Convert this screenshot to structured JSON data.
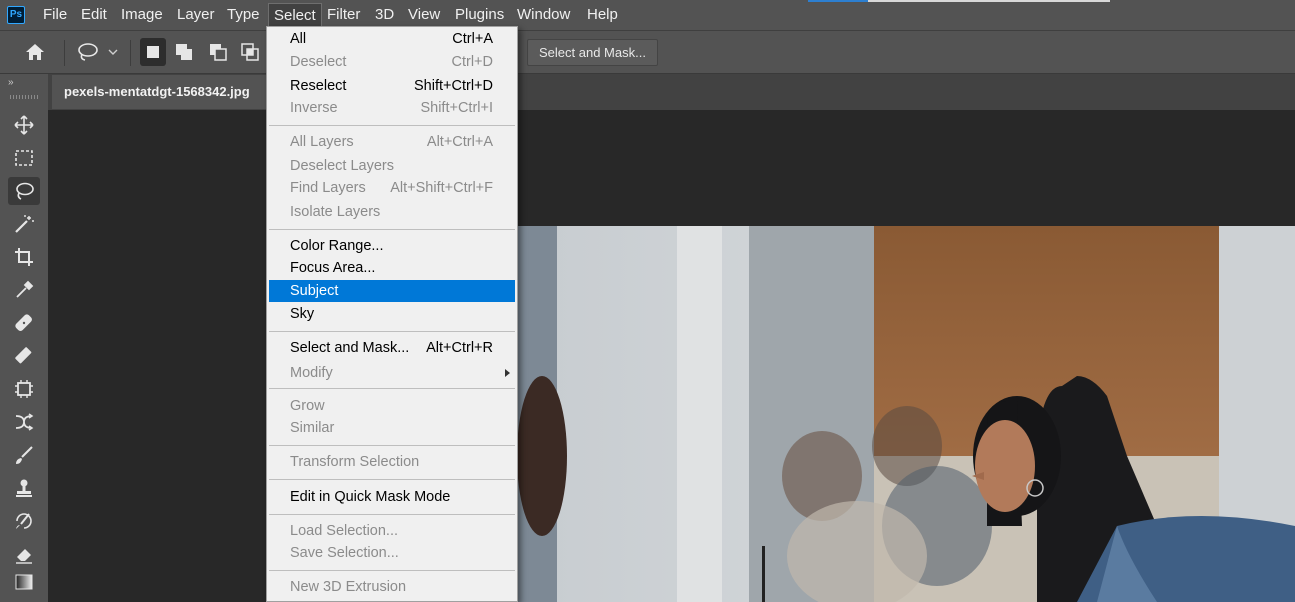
{
  "app": {
    "logo": "Ps"
  },
  "menubar": [
    "File",
    "Edit",
    "Image",
    "Layer",
    "Type",
    "Select",
    "Filter",
    "3D",
    "View",
    "Plugins",
    "Window",
    "Help"
  ],
  "options": {
    "select_and_mask": "Select and Mask..."
  },
  "toolbar": {
    "collapse": "»"
  },
  "document": {
    "tab_title": "pexels-mentatdgt-1568342.jpg"
  },
  "select_menu": {
    "items": [
      {
        "label": "All",
        "shortcut": "Ctrl+A",
        "enabled": true
      },
      {
        "label": "Deselect",
        "shortcut": "Ctrl+D",
        "enabled": false
      },
      {
        "label": "Reselect",
        "shortcut": "Shift+Ctrl+D",
        "enabled": true
      },
      {
        "label": "Inverse",
        "shortcut": "Shift+Ctrl+I",
        "enabled": false
      },
      {
        "label": "All Layers",
        "shortcut": "Alt+Ctrl+A",
        "enabled": false
      },
      {
        "label": "Deselect Layers",
        "shortcut": "",
        "enabled": false
      },
      {
        "label": "Find Layers",
        "shortcut": "Alt+Shift+Ctrl+F",
        "enabled": false
      },
      {
        "label": "Isolate Layers",
        "shortcut": "",
        "enabled": false
      },
      {
        "label": "Color Range...",
        "shortcut": "",
        "enabled": true
      },
      {
        "label": "Focus Area...",
        "shortcut": "",
        "enabled": true
      },
      {
        "label": "Subject",
        "shortcut": "",
        "enabled": true,
        "highlighted": true
      },
      {
        "label": "Sky",
        "shortcut": "",
        "enabled": true
      },
      {
        "label": "Select and Mask...",
        "shortcut": "Alt+Ctrl+R",
        "enabled": true
      },
      {
        "label": "Modify",
        "shortcut": "",
        "enabled": false,
        "submenu": true
      },
      {
        "label": "Grow",
        "shortcut": "",
        "enabled": false
      },
      {
        "label": "Similar",
        "shortcut": "",
        "enabled": false
      },
      {
        "label": "Transform Selection",
        "shortcut": "",
        "enabled": false
      },
      {
        "label": "Edit in Quick Mask Mode",
        "shortcut": "",
        "enabled": true
      },
      {
        "label": "Load Selection...",
        "shortcut": "",
        "enabled": false
      },
      {
        "label": "Save Selection...",
        "shortcut": "",
        "enabled": false
      },
      {
        "label": "New 3D Extrusion",
        "shortcut": "",
        "enabled": false
      }
    ]
  },
  "colors": {
    "menu_highlight": "#0078d7",
    "chrome": "#535353",
    "canvas": "#282828"
  }
}
